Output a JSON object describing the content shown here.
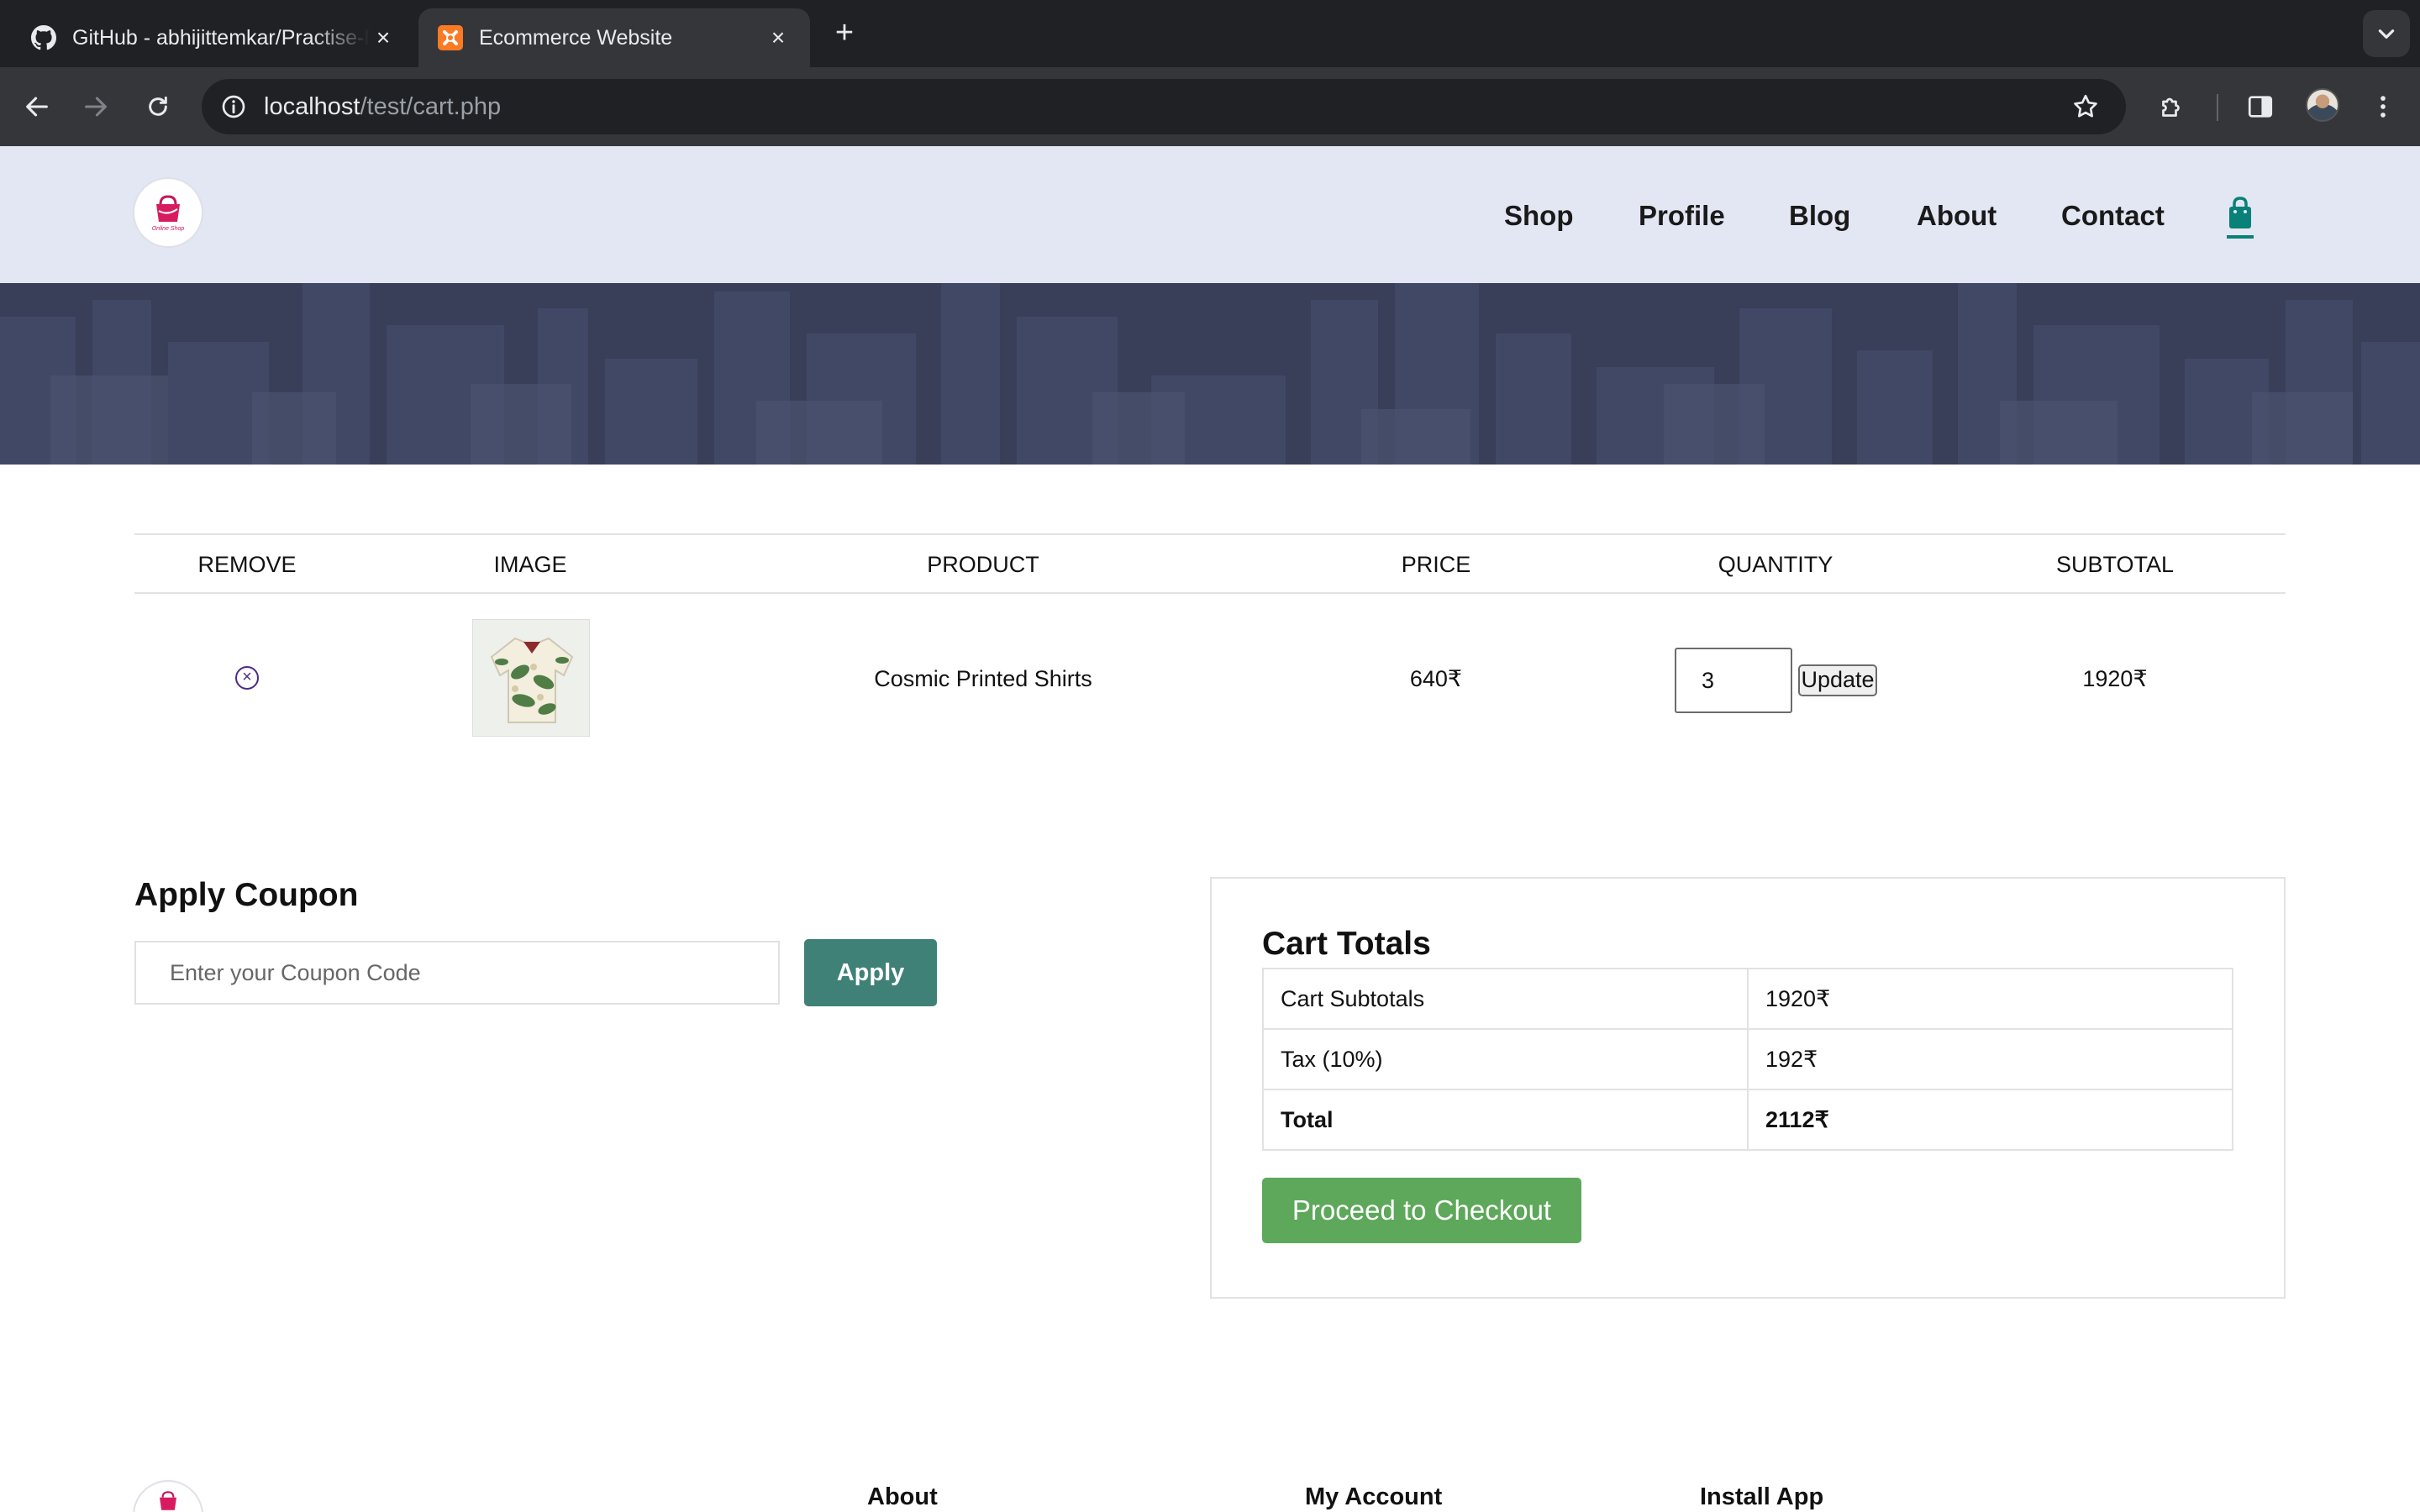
{
  "browser": {
    "tabs": [
      {
        "title": "GitHub - abhijittemkar/Practise-Project",
        "favicon": "github-icon",
        "active": false
      },
      {
        "title": "Ecommerce Website",
        "favicon": "xampp-icon",
        "active": true
      }
    ],
    "url_host": "localhost",
    "url_path": "/test/cart.php"
  },
  "header": {
    "logo_text": "Online Shop",
    "nav": [
      "Shop",
      "Profile",
      "Blog",
      "About",
      "Contact"
    ],
    "cart_icon": "shopping-bag-icon",
    "accent_color": "#088178"
  },
  "cart": {
    "columns": [
      "REMOVE",
      "IMAGE",
      "PRODUCT",
      "PRICE",
      "QUANTITY",
      "SUBTOTAL"
    ],
    "rows": [
      {
        "product": "Cosmic Printed Shirts",
        "price": "640₹",
        "quantity": "3",
        "update_label": "Update",
        "subtotal": "1920₹"
      }
    ]
  },
  "coupon": {
    "title": "Apply Coupon",
    "placeholder": "Enter your Coupon Code",
    "button": "Apply",
    "button_color": "#3f8177"
  },
  "totals": {
    "title": "Cart Totals",
    "rows": [
      {
        "label": "Cart Subtotals",
        "value": "1920₹"
      },
      {
        "label": "Tax (10%)",
        "value": "192₹"
      },
      {
        "label": "Total",
        "value": "2112₹"
      }
    ],
    "checkout_label": "Proceed to Checkout",
    "checkout_color": "#5da85a"
  },
  "footer": {
    "headings": [
      "About",
      "My Account",
      "Install App"
    ]
  }
}
